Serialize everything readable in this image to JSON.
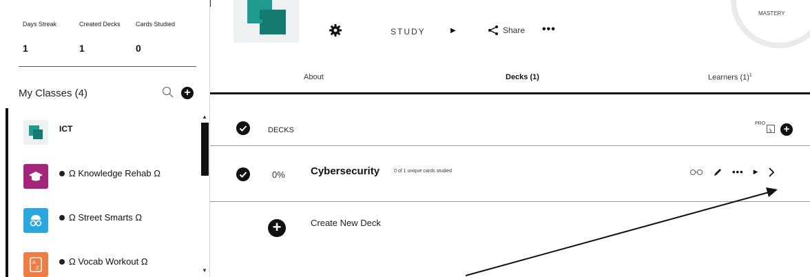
{
  "stats": [
    {
      "label": "Days Streak",
      "value": "1"
    },
    {
      "label": "Created Decks",
      "value": "1"
    },
    {
      "label": "Cards Studied",
      "value": "0"
    }
  ],
  "classes": {
    "header": "My Classes (4)",
    "items": [
      {
        "name": "ICT",
        "color": "#1e9a8e",
        "icon": "stacked-squares-icon",
        "dot": false
      },
      {
        "name": "Ω Knowledge Rehab Ω",
        "color": "#a3257c",
        "icon": "graduation-cap-icon",
        "dot": true
      },
      {
        "name": "Ω Street Smarts Ω",
        "color": "#29a8e0",
        "icon": "brain-glasses-icon",
        "dot": true
      },
      {
        "name": "Ω Vocab Workout Ω",
        "color": "#ef7d43",
        "icon": "a-to-z-icon",
        "dot": true
      }
    ]
  },
  "deck_header": {
    "study_label": "STUDY",
    "share_label": "Share",
    "mastery_label": "MASTERY"
  },
  "tabs": {
    "about": "About",
    "decks": "Decks (1)",
    "learners": "Learners (1)",
    "learners_sup": "1"
  },
  "decks_section": {
    "label": "DECKS",
    "pro_label": "PRO"
  },
  "deck": {
    "percent": "0%",
    "name": "Cybersecurity",
    "progress": "0 of 1 unique cards studied"
  },
  "create": {
    "label": "Create New Deck"
  },
  "colors": {
    "brand": "#1e9a8e",
    "ink": "#111111"
  }
}
